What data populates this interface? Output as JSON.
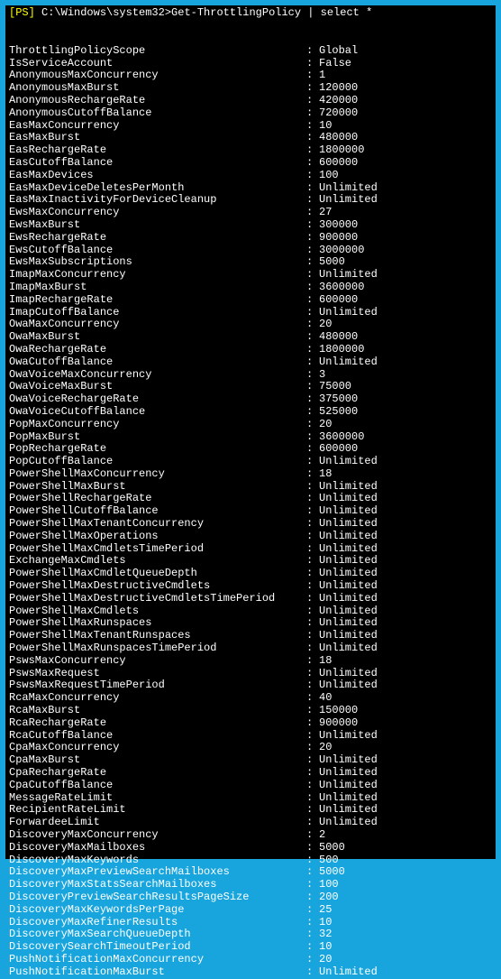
{
  "prompt": {
    "tag": "[PS]",
    "path": "C:\\Windows\\system32>",
    "command": "Get-ThrottlingPolicy | select *"
  },
  "rows": [
    {
      "k": "ThrottlingPolicyScope",
      "v": "Global"
    },
    {
      "k": "IsServiceAccount",
      "v": "False"
    },
    {
      "k": "AnonymousMaxConcurrency",
      "v": "1"
    },
    {
      "k": "AnonymousMaxBurst",
      "v": "120000"
    },
    {
      "k": "AnonymousRechargeRate",
      "v": "420000"
    },
    {
      "k": "AnonymousCutoffBalance",
      "v": "720000"
    },
    {
      "k": "EasMaxConcurrency",
      "v": "10"
    },
    {
      "k": "EasMaxBurst",
      "v": "480000"
    },
    {
      "k": "EasRechargeRate",
      "v": "1800000"
    },
    {
      "k": "EasCutoffBalance",
      "v": "600000"
    },
    {
      "k": "EasMaxDevices",
      "v": "100"
    },
    {
      "k": "EasMaxDeviceDeletesPerMonth",
      "v": "Unlimited"
    },
    {
      "k": "EasMaxInactivityForDeviceCleanup",
      "v": "Unlimited"
    },
    {
      "k": "EwsMaxConcurrency",
      "v": "27"
    },
    {
      "k": "EwsMaxBurst",
      "v": "300000"
    },
    {
      "k": "EwsRechargeRate",
      "v": "900000"
    },
    {
      "k": "EwsCutoffBalance",
      "v": "3000000"
    },
    {
      "k": "EwsMaxSubscriptions",
      "v": "5000"
    },
    {
      "k": "ImapMaxConcurrency",
      "v": "Unlimited"
    },
    {
      "k": "ImapMaxBurst",
      "v": "3600000"
    },
    {
      "k": "ImapRechargeRate",
      "v": "600000"
    },
    {
      "k": "ImapCutoffBalance",
      "v": "Unlimited"
    },
    {
      "k": "OwaMaxConcurrency",
      "v": "20"
    },
    {
      "k": "OwaMaxBurst",
      "v": "480000"
    },
    {
      "k": "OwaRechargeRate",
      "v": "1800000"
    },
    {
      "k": "OwaCutoffBalance",
      "v": "Unlimited"
    },
    {
      "k": "OwaVoiceMaxConcurrency",
      "v": "3"
    },
    {
      "k": "OwaVoiceMaxBurst",
      "v": "75000"
    },
    {
      "k": "OwaVoiceRechargeRate",
      "v": "375000"
    },
    {
      "k": "OwaVoiceCutoffBalance",
      "v": "525000"
    },
    {
      "k": "PopMaxConcurrency",
      "v": "20"
    },
    {
      "k": "PopMaxBurst",
      "v": "3600000"
    },
    {
      "k": "PopRechargeRate",
      "v": "600000"
    },
    {
      "k": "PopCutoffBalance",
      "v": "Unlimited"
    },
    {
      "k": "PowerShellMaxConcurrency",
      "v": "18"
    },
    {
      "k": "PowerShellMaxBurst",
      "v": "Unlimited"
    },
    {
      "k": "PowerShellRechargeRate",
      "v": "Unlimited"
    },
    {
      "k": "PowerShellCutoffBalance",
      "v": "Unlimited"
    },
    {
      "k": "PowerShellMaxTenantConcurrency",
      "v": "Unlimited"
    },
    {
      "k": "PowerShellMaxOperations",
      "v": "Unlimited"
    },
    {
      "k": "PowerShellMaxCmdletsTimePeriod",
      "v": "Unlimited"
    },
    {
      "k": "ExchangeMaxCmdlets",
      "v": "Unlimited"
    },
    {
      "k": "PowerShellMaxCmdletQueueDepth",
      "v": "Unlimited"
    },
    {
      "k": "PowerShellMaxDestructiveCmdlets",
      "v": "Unlimited"
    },
    {
      "k": "PowerShellMaxDestructiveCmdletsTimePeriod",
      "v": "Unlimited"
    },
    {
      "k": "PowerShellMaxCmdlets",
      "v": "Unlimited"
    },
    {
      "k": "PowerShellMaxRunspaces",
      "v": "Unlimited"
    },
    {
      "k": "PowerShellMaxTenantRunspaces",
      "v": "Unlimited"
    },
    {
      "k": "PowerShellMaxRunspacesTimePeriod",
      "v": "Unlimited"
    },
    {
      "k": "PswsMaxConcurrency",
      "v": "18"
    },
    {
      "k": "PswsMaxRequest",
      "v": "Unlimited"
    },
    {
      "k": "PswsMaxRequestTimePeriod",
      "v": "Unlimited"
    },
    {
      "k": "RcaMaxConcurrency",
      "v": "40"
    },
    {
      "k": "RcaMaxBurst",
      "v": "150000"
    },
    {
      "k": "RcaRechargeRate",
      "v": "900000"
    },
    {
      "k": "RcaCutoffBalance",
      "v": "Unlimited"
    },
    {
      "k": "CpaMaxConcurrency",
      "v": "20"
    },
    {
      "k": "CpaMaxBurst",
      "v": "Unlimited"
    },
    {
      "k": "CpaRechargeRate",
      "v": "Unlimited"
    },
    {
      "k": "CpaCutoffBalance",
      "v": "Unlimited"
    },
    {
      "k": "MessageRateLimit",
      "v": "Unlimited"
    },
    {
      "k": "RecipientRateLimit",
      "v": "Unlimited"
    },
    {
      "k": "ForwardeeLimit",
      "v": "Unlimited"
    },
    {
      "k": "DiscoveryMaxConcurrency",
      "v": "2"
    },
    {
      "k": "DiscoveryMaxMailboxes",
      "v": "5000"
    },
    {
      "k": "DiscoveryMaxKeywords",
      "v": "500"
    },
    {
      "k": "DiscoveryMaxPreviewSearchMailboxes",
      "v": "5000"
    },
    {
      "k": "DiscoveryMaxStatsSearchMailboxes",
      "v": "100"
    },
    {
      "k": "DiscoveryPreviewSearchResultsPageSize",
      "v": "200"
    },
    {
      "k": "DiscoveryMaxKeywordsPerPage",
      "v": "25"
    },
    {
      "k": "DiscoveryMaxRefinerResults",
      "v": "10"
    },
    {
      "k": "DiscoveryMaxSearchQueueDepth",
      "v": "32"
    },
    {
      "k": "DiscoverySearchTimeoutPeriod",
      "v": "10"
    },
    {
      "k": "PushNotificationMaxConcurrency",
      "v": "20"
    },
    {
      "k": "PushNotificationMaxBurst",
      "v": "Unlimited"
    }
  ]
}
